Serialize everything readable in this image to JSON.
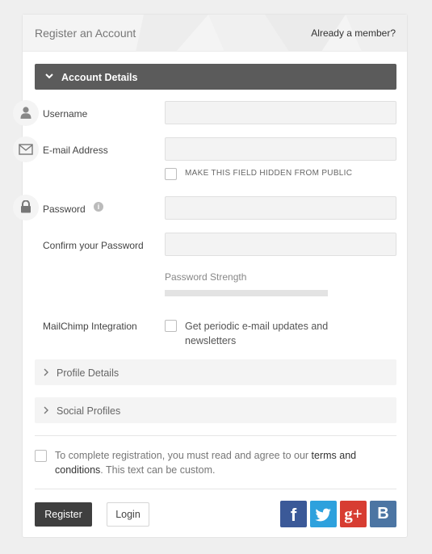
{
  "header": {
    "title": "Register an Account",
    "member_link": "Already a member?"
  },
  "account_details": {
    "title": "Account Details",
    "username_label": "Username",
    "email_label": "E-mail Address",
    "hide_email_label": "MAKE THIS FIELD HIDDEN FROM PUBLIC",
    "password_label": "Password",
    "password_info": "i",
    "confirm_label": "Confirm your Password",
    "strength_label": "Password Strength",
    "mailchimp_label": "MailChimp Integration",
    "mailchimp_option": "Get periodic e-mail updates and newsletters"
  },
  "sections": {
    "profile": "Profile Details",
    "social": "Social Profiles"
  },
  "terms": {
    "prefix": "To complete registration, you must read and agree to our ",
    "link": "terms and conditions",
    "suffix": ". This text can be custom."
  },
  "actions": {
    "register": "Register",
    "login": "Login"
  },
  "social_buttons": {
    "facebook": {
      "glyph": "f",
      "color": "#3b5998"
    },
    "twitter": {
      "glyph": "twitter-bird-icon",
      "color": "#2ea1dd"
    },
    "googleplus": {
      "glyph": "g+",
      "color": "#d73d32"
    },
    "vk": {
      "glyph": "B",
      "color": "#4c75a3"
    }
  }
}
